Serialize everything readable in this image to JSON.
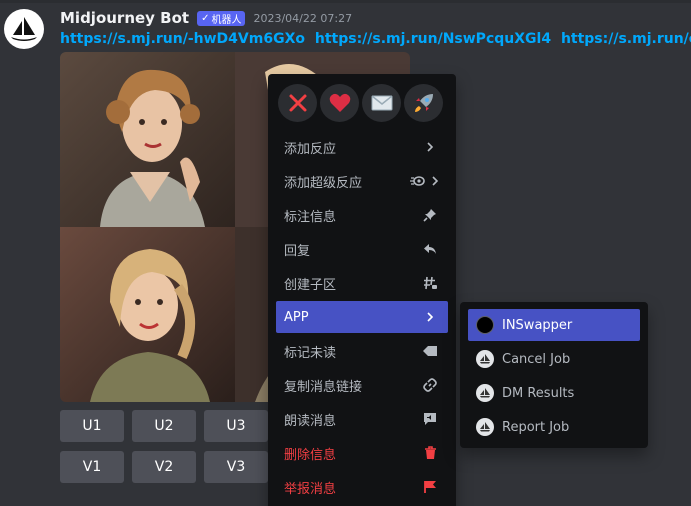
{
  "message": {
    "username": "Midjourney Bot",
    "bot_badge": "机器人",
    "timestamp": "2023/04/22 07:27",
    "links": [
      "https://s.mj.run/-hwD4Vm6GXo",
      "https://s.mj.run/NswPcquXGl4",
      "https://s.mj.run/cuALLQ"
    ]
  },
  "buttons": {
    "row1": [
      "U1",
      "U2",
      "U3"
    ],
    "row2": [
      "V1",
      "V2",
      "V3"
    ]
  },
  "context_menu": {
    "reactions": [
      "cross-mark-icon",
      "heart-icon",
      "envelope-icon",
      "rocket-icon"
    ],
    "items": [
      {
        "label": "添加反应",
        "icon": "chevron-right-icon"
      },
      {
        "label": "添加超级反应",
        "icon": "chevron-right-icon"
      },
      {
        "label": "标注信息",
        "icon": "pin-icon"
      },
      {
        "label": "回复",
        "icon": "reply-icon"
      },
      {
        "label": "创建子区",
        "icon": "thread-icon"
      },
      {
        "label": "APP",
        "icon": "chevron-right-icon"
      },
      {
        "label": "标记未读",
        "icon": "mark-unread-icon"
      },
      {
        "label": "复制消息链接",
        "icon": "link-icon"
      },
      {
        "label": "朗读消息",
        "icon": "speaker-icon"
      },
      {
        "label": "删除信息",
        "icon": "trash-icon"
      },
      {
        "label": "举报消息",
        "icon": "flag-icon"
      }
    ]
  },
  "app_submenu": {
    "items": [
      {
        "label": "INSwapper"
      },
      {
        "label": "Cancel Job"
      },
      {
        "label": "DM Results"
      },
      {
        "label": "Report Job"
      }
    ]
  },
  "colors": {
    "background": "#313338",
    "menu": "#111214",
    "accent": "#4752c4",
    "danger": "#f23f43",
    "link": "#00a8fc"
  }
}
